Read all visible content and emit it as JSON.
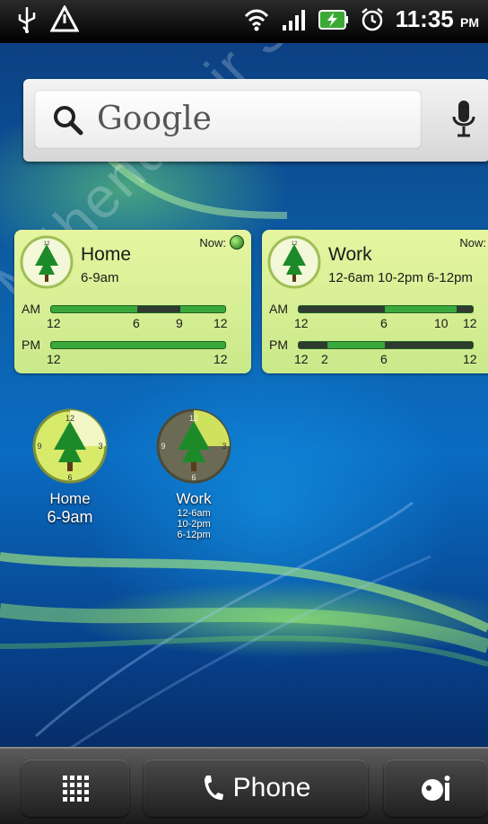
{
  "status": {
    "time": "11:35",
    "ampm": "PM"
  },
  "search": {
    "label": "Google"
  },
  "watermark": "Mühendisnir Sanayi Oo",
  "widgets": [
    {
      "name": "Home",
      "hours": "6-9am",
      "now_label": "Now:",
      "am_label": "AM",
      "pm_label": "PM",
      "am_ticks": [
        "12",
        "6",
        "9",
        "12"
      ],
      "pm_ticks": [
        "12",
        "12"
      ]
    },
    {
      "name": "Work",
      "hours": "12-6am 10-2pm 6-12pm",
      "now_label": "Now:",
      "am_label": "AM",
      "pm_label": "PM",
      "am_ticks": [
        "12",
        "6",
        "10",
        "12"
      ],
      "pm_ticks": [
        "12",
        "2",
        "6",
        "12"
      ]
    }
  ],
  "shortcuts": [
    {
      "title": "Home",
      "sub": "6-9am"
    },
    {
      "title": "Work",
      "sub_lines": [
        "12-6am",
        "10-2pm",
        "6-12pm"
      ]
    }
  ],
  "dock": {
    "phone_label": "Phone"
  }
}
